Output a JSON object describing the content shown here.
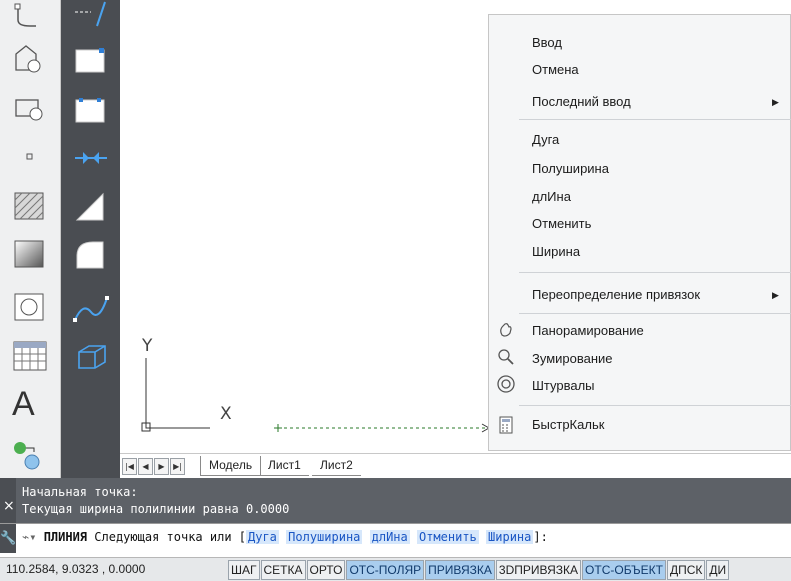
{
  "toolbar_left": {
    "text_tool": "A"
  },
  "layout_tabs": {
    "nav_buttons": [
      "|◀",
      "◀",
      "▶",
      "▶|"
    ],
    "tabs": [
      "Модель",
      "Лист1",
      "Лист2"
    ]
  },
  "canvas": {
    "ucs_x_label": "X",
    "ucs_y_label": "Y"
  },
  "command_history": {
    "close": "×",
    "lines": [
      "Начальная точка:",
      "Текущая ширина полилинии равна 0.0000"
    ]
  },
  "command_line": {
    "command": "ПЛИНИЯ",
    "prompt": "Следующая точка или [",
    "options": [
      "Дуга",
      "Полуширина",
      "длИна",
      "Отменить",
      "Ширина"
    ],
    "suffix": "]:"
  },
  "status_bar": {
    "coordinates": "110.2584, 9.0323 , 0.0000",
    "buttons": [
      {
        "label": "ШАГ",
        "on": false
      },
      {
        "label": "СЕТКА",
        "on": false
      },
      {
        "label": "ОРТО",
        "on": false
      },
      {
        "label": "ОТС-ПОЛЯР",
        "on": true
      },
      {
        "label": "ПРИВЯЗКА",
        "on": true
      },
      {
        "label": "3DПРИВЯЗКА",
        "on": false
      },
      {
        "label": "ОТС-ОБЪЕКТ",
        "on": true
      },
      {
        "label": "ДПСК",
        "on": false
      },
      {
        "label": "ДИ",
        "on": false
      }
    ]
  },
  "context_menu": {
    "group1": [
      "Ввод",
      "Отмена",
      "Последний ввод"
    ],
    "group2": [
      "Дуга",
      "Полуширина",
      "длИна",
      "Отменить",
      "Ширина"
    ],
    "group3": [
      "Переопределение привязок"
    ],
    "group4": [
      "Панорамирование",
      "Зумирование",
      "Штурвалы"
    ],
    "group5": [
      "БыстрКальк"
    ],
    "submenu_arrow": "▶"
  },
  "colors": {
    "command_bg": "#5d6167",
    "status_on": "#a9cdee",
    "option_text": "#1a56c4",
    "toolbar_dark": "#4a4d52"
  }
}
